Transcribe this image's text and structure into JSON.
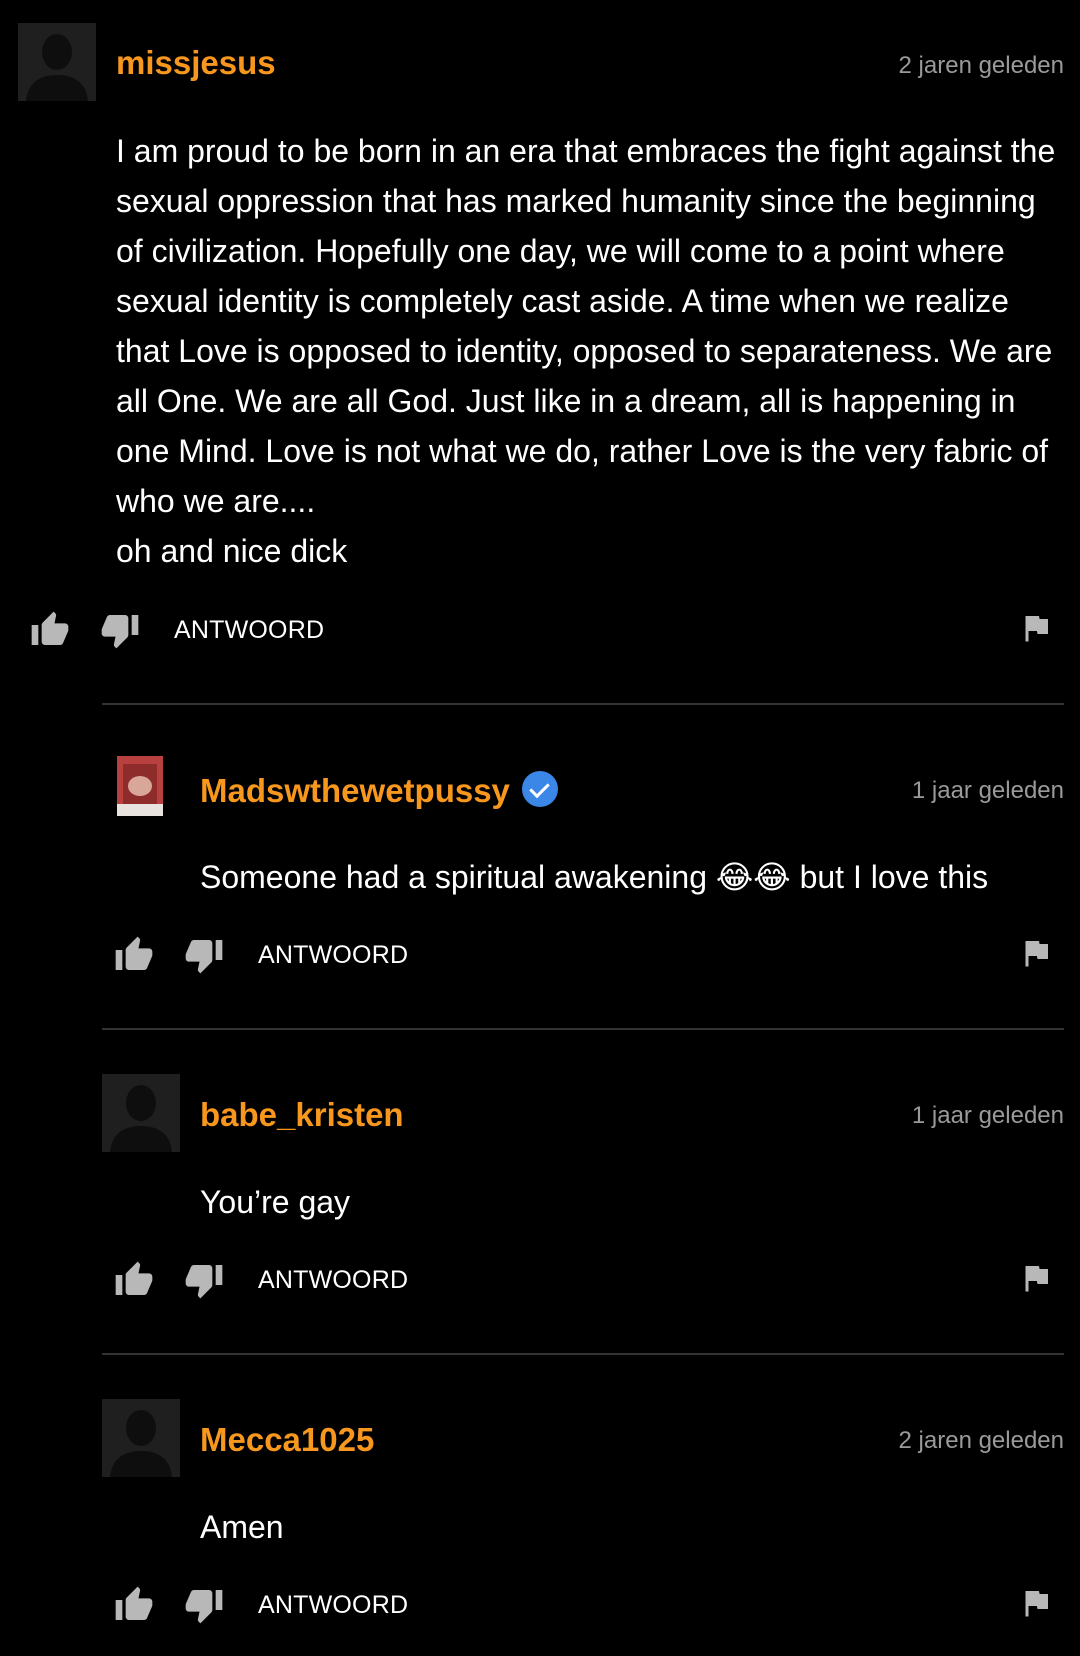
{
  "comments": [
    {
      "username": "missjesus",
      "timestamp": "2 jaren geleden",
      "text": "I am proud to be born in an era that embraces the fight against the sexual oppression that has marked humanity since the beginning of civilization. Hopefully one day, we will come to a point where sexual identity is completely cast aside. A time when we realize that Love is opposed to identity, opposed to separateness. We are all One. We are all God. Just like in a dream, all is happening in one Mind. Love is not what we do, rather Love is the very fabric of who we are....\noh and nice dick",
      "reply_label": "ANTWOORD",
      "verified": false
    },
    {
      "username": "Madswthewetpussy",
      "timestamp": "1 jaar geleden",
      "text": "Someone had a spiritual awakening 😂😂 but I love this",
      "reply_label": "ANTWOORD",
      "verified": true
    },
    {
      "username": "babe_kristen",
      "timestamp": "1 jaar geleden",
      "text": "You’re gay",
      "reply_label": "ANTWOORD",
      "verified": false
    },
    {
      "username": "Mecca1025",
      "timestamp": "2 jaren geleden",
      "text": "Amen",
      "reply_label": "ANTWOORD",
      "verified": false
    }
  ],
  "colors": {
    "background": "#000000",
    "username": "#f7971d",
    "timestamp": "#9a9a9a",
    "icon": "#b8b8b8",
    "verified": "#3b87e8"
  },
  "icons": {
    "like": "thumbs-up-icon",
    "dislike": "thumbs-down-icon",
    "flag": "flag-icon",
    "verified": "verified-badge-icon",
    "avatar": "default-avatar-icon"
  }
}
